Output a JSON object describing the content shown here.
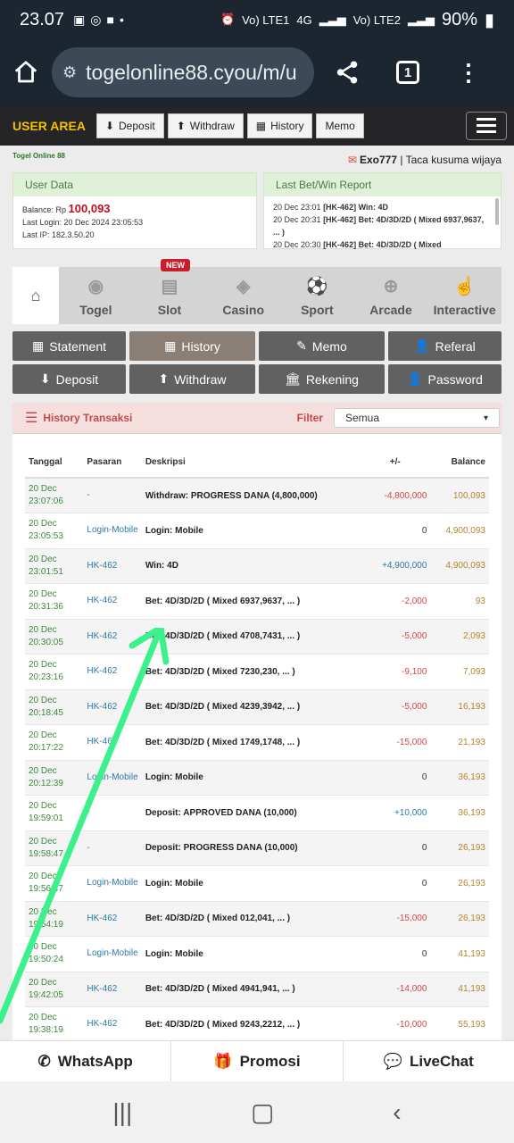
{
  "status": {
    "time": "23.07",
    "sim1": "Vo) LTE1",
    "net1": "4G",
    "sim2": "Vo) LTE2",
    "battery": "90%"
  },
  "browser": {
    "url": "togelonline88.cyou/m/u",
    "tabs_count": "1"
  },
  "topnav": {
    "title": "USER AREA",
    "deposit": "Deposit",
    "withdraw": "Withdraw",
    "history": "History",
    "memo": "Memo"
  },
  "site": {
    "logo": "Togel Online 88",
    "member_name": "Exo777",
    "member_sep": " | ",
    "member_fullname": "Taca kusuma wijaya"
  },
  "userdata": {
    "header": "User Data",
    "balance_label": "Balance: Rp",
    "balance": "100,093",
    "last_login": "Last Login: 20 Dec 2024 23:05:53",
    "last_ip": "Last IP: 182.3.50.20"
  },
  "lastbet": {
    "header": "Last Bet/Win Report",
    "lines": [
      {
        "time": "20 Dec 23:01",
        "text": "[HK-462] Win: 4D"
      },
      {
        "time": "20 Dec 20:31",
        "text": "[HK-462] Bet: 4D/3D/2D ( Mixed 6937,9637, ... )"
      },
      {
        "time": "20 Dec 20:30",
        "text": "[HK-462] Bet: 4D/3D/2D ( Mixed"
      }
    ]
  },
  "game_tabs": {
    "new_badge": "NEW",
    "items": [
      "Togel",
      "Slot",
      "Casino",
      "Sport",
      "Arcade",
      "Interactive"
    ]
  },
  "menu": {
    "statement": "Statement",
    "history": "History",
    "memo": "Memo",
    "referal": "Referal",
    "deposit": "Deposit",
    "withdraw": "Withdraw",
    "rekening": "Rekening",
    "password": "Password"
  },
  "history": {
    "title": "History Transaksi",
    "filter_label": "Filter",
    "filter_value": "Semua",
    "columns": [
      "Tanggal",
      "Pasaran",
      "Deskripsi",
      "+/-",
      "Balance"
    ],
    "rows": [
      {
        "date": "20 Dec",
        "time": "23:07:06",
        "market": "-",
        "desc": "Withdraw: PROGRESS DANA (4,800,000)",
        "amount": "-4,800,000",
        "sign": "neg",
        "balance": "100,093"
      },
      {
        "date": "20 Dec",
        "time": "23:05:53",
        "market": "Login-Mobile",
        "desc": "Login: Mobile",
        "amount": "0",
        "sign": "zer",
        "balance": "4,900,093"
      },
      {
        "date": "20 Dec",
        "time": "23:01:51",
        "market": "HK-462",
        "desc": "Win: 4D",
        "amount": "+4,900,000",
        "sign": "pos",
        "balance": "4,900,093"
      },
      {
        "date": "20 Dec",
        "time": "20:31:36",
        "market": "HK-462",
        "desc": "Bet: 4D/3D/2D ( Mixed 6937,9637, ... )",
        "amount": "-2,000",
        "sign": "neg",
        "balance": "93"
      },
      {
        "date": "20 Dec",
        "time": "20:30:05",
        "market": "HK-462",
        "desc": "Bet: 4D/3D/2D ( Mixed 4708,7431, ... )",
        "amount": "-5,000",
        "sign": "neg",
        "balance": "2,093"
      },
      {
        "date": "20 Dec",
        "time": "20:23:16",
        "market": "HK-462",
        "desc": "Bet: 4D/3D/2D ( Mixed 7230,230, ... )",
        "amount": "-9,100",
        "sign": "neg",
        "balance": "7,093"
      },
      {
        "date": "20 Dec",
        "time": "20:18:45",
        "market": "HK-462",
        "desc": "Bet: 4D/3D/2D ( Mixed 4239,3942, ... )",
        "amount": "-5,000",
        "sign": "neg",
        "balance": "16,193"
      },
      {
        "date": "20 Dec",
        "time": "20:17:22",
        "market": "HK-462",
        "desc": "Bet: 4D/3D/2D ( Mixed 1749,1748, ... )",
        "amount": "-15,000",
        "sign": "neg",
        "balance": "21,193"
      },
      {
        "date": "20 Dec",
        "time": "20:12:39",
        "market": "Login-Mobile",
        "desc": "Login: Mobile",
        "amount": "0",
        "sign": "zer",
        "balance": "36,193"
      },
      {
        "date": "20 Dec",
        "time": "19:59:01",
        "market": "-",
        "desc": "Deposit: APPROVED DANA (10,000)",
        "amount": "+10,000",
        "sign": "pos",
        "balance": "36,193"
      },
      {
        "date": "20 Dec",
        "time": "19:58:47",
        "market": "-",
        "desc": "Deposit: PROGRESS DANA (10,000)",
        "amount": "0",
        "sign": "zer",
        "balance": "26,193"
      },
      {
        "date": "20 Dec",
        "time": "19:56:47",
        "market": "Login-Mobile",
        "desc": "Login: Mobile",
        "amount": "0",
        "sign": "zer",
        "balance": "26,193"
      },
      {
        "date": "20 Dec",
        "time": "19:54:19",
        "market": "HK-462",
        "desc": "Bet: 4D/3D/2D ( Mixed 012,041, ... )",
        "amount": "-15,000",
        "sign": "neg",
        "balance": "26,193"
      },
      {
        "date": "20 Dec",
        "time": "19:50:24",
        "market": "Login-Mobile",
        "desc": "Login: Mobile",
        "amount": "0",
        "sign": "zer",
        "balance": "41,193"
      },
      {
        "date": "20 Dec",
        "time": "19:42:05",
        "market": "HK-462",
        "desc": "Bet: 4D/3D/2D ( Mixed 4941,941, ... )",
        "amount": "-14,000",
        "sign": "neg",
        "balance": "41,193"
      },
      {
        "date": "20 Dec",
        "time": "19:38:19",
        "market": "HK-462",
        "desc": "Bet: 4D/3D/2D ( Mixed 9243,2212, ... )",
        "amount": "-10,000",
        "sign": "neg",
        "balance": "55,193"
      }
    ]
  },
  "bottom": {
    "whatsapp": "WhatsApp",
    "promosi": "Promosi",
    "livechat": "LiveChat"
  },
  "colors": {
    "accent": "#f5c000",
    "arrow": "#3cf08c",
    "negative": "#d64545",
    "positive": "#2d79a8"
  }
}
